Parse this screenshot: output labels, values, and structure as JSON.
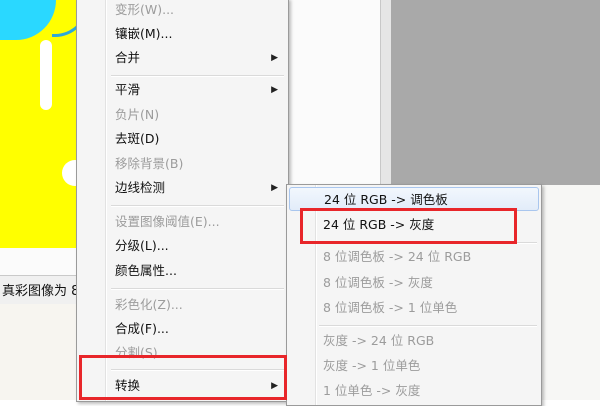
{
  "status_bar": {
    "text": "真彩图像为 8"
  },
  "menu": {
    "items": [
      {
        "label": "变形(W)...",
        "disabled": true,
        "submenu": false
      },
      {
        "label": "镶嵌(M)...",
        "disabled": false,
        "submenu": false
      },
      {
        "label": "合并",
        "disabled": false,
        "submenu": true
      },
      {
        "label": "平滑",
        "disabled": false,
        "submenu": true
      },
      {
        "label": "负片(N)",
        "disabled": true,
        "submenu": false
      },
      {
        "label": "去斑(D)",
        "disabled": false,
        "submenu": false
      },
      {
        "label": "移除背景(B)",
        "disabled": true,
        "submenu": false
      },
      {
        "label": "边线检测",
        "disabled": false,
        "submenu": true
      },
      {
        "label": "设置图像阈值(E)...",
        "disabled": true,
        "submenu": false
      },
      {
        "label": "分级(L)...",
        "disabled": false,
        "submenu": false
      },
      {
        "label": "颜色属性...",
        "disabled": false,
        "submenu": false
      },
      {
        "label": "彩色化(Z)...",
        "disabled": true,
        "submenu": false
      },
      {
        "label": "合成(F)...",
        "disabled": false,
        "submenu": false
      },
      {
        "label": "分割(S)",
        "disabled": true,
        "submenu": false
      },
      {
        "label": "转换",
        "disabled": false,
        "submenu": true
      }
    ],
    "arrow_glyph": "▶"
  },
  "submenu": {
    "items": [
      {
        "label": "24 位 RGB -> 调色板",
        "disabled": false
      },
      {
        "label": "24 位 RGB -> 灰度",
        "disabled": false
      },
      {
        "label": "8 位调色板 -> 24 位 RGB",
        "disabled": true
      },
      {
        "label": "8 位调色板 -> 灰度",
        "disabled": true
      },
      {
        "label": "8 位调色板 -> 1 位单色",
        "disabled": true
      },
      {
        "label": "灰度 -> 24 位 RGB",
        "disabled": true
      },
      {
        "label": "灰度 -> 1 位单色",
        "disabled": true
      },
      {
        "label": "1 位单色 -> 灰度",
        "disabled": true
      }
    ]
  },
  "colors": {
    "highlight_box": "#e8262a",
    "canvas_yellow": "#ffff00",
    "workspace_gray": "#a9a9a9"
  }
}
